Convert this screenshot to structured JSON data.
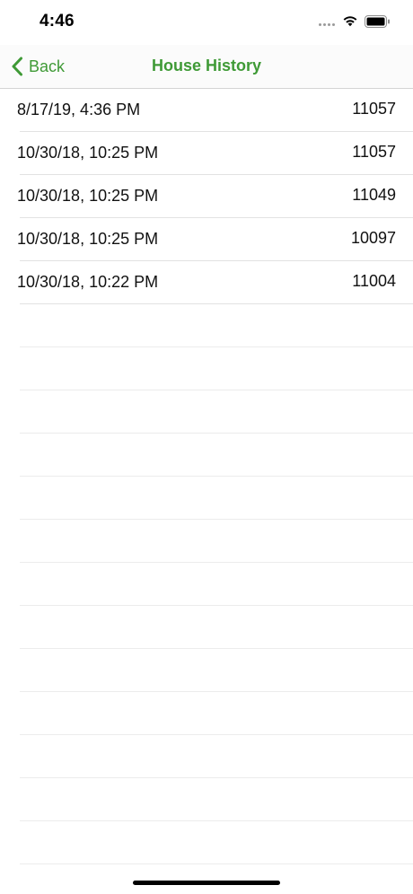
{
  "status_bar": {
    "time": "4:46"
  },
  "nav": {
    "back_label": "Back",
    "title": "House History",
    "accent_color": "#3f9a36"
  },
  "history": [
    {
      "date": "8/17/19, 4:36 PM",
      "value": "11057"
    },
    {
      "date": "10/30/18, 10:25 PM",
      "value": "11057"
    },
    {
      "date": "10/30/18, 10:25 PM",
      "value": "11049"
    },
    {
      "date": "10/30/18, 10:25 PM",
      "value": "10097"
    },
    {
      "date": "10/30/18, 10:22 PM",
      "value": "11004"
    }
  ],
  "icons": {
    "back": "chevron-left-icon",
    "wifi": "wifi-icon",
    "battery": "battery-icon",
    "signal": "signal-dots-icon"
  }
}
